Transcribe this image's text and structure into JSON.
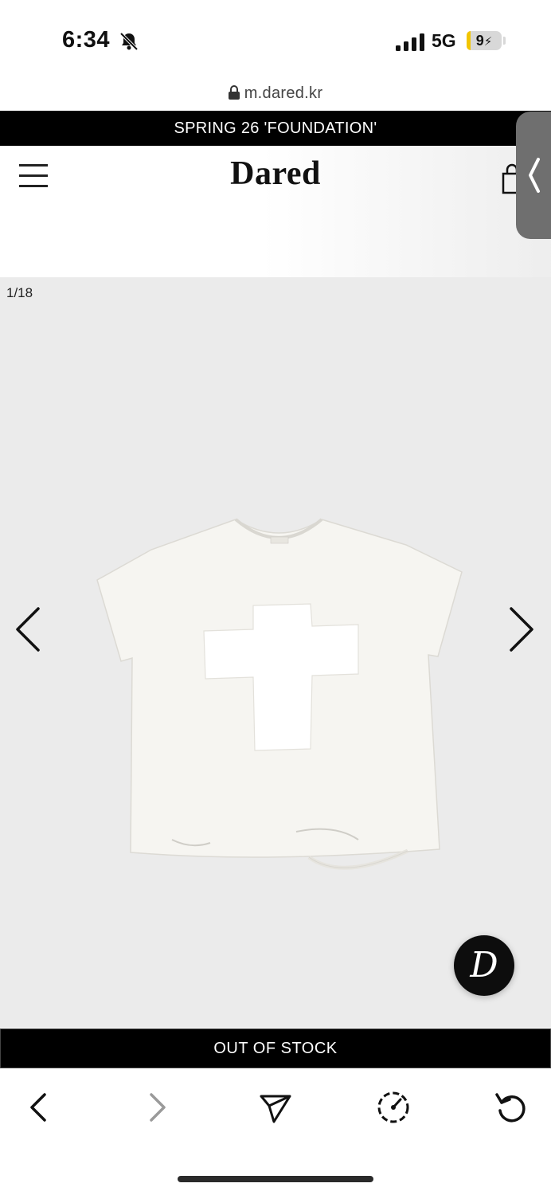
{
  "status_bar": {
    "time": "6:34",
    "network": "5G",
    "battery_level": "9",
    "battery_fraction": 0.09,
    "icons": [
      "bell-slash-icon",
      "signal-icon",
      "battery-charging-icon"
    ]
  },
  "browser": {
    "url": "m.dared.kr"
  },
  "announcement": {
    "text": "SPRING 26 'FOUNDATION'"
  },
  "header": {
    "logo": "Dared",
    "icons": [
      "menu-icon",
      "shopping-bag-icon",
      "side-panel-chevron-icon"
    ]
  },
  "gallery": {
    "counter": "1/18",
    "image_alt": "white t-shirt with cross patch",
    "badge_letter": "D"
  },
  "product": {
    "stock_label": "OUT OF STOCK"
  },
  "toolbar": {
    "buttons": [
      "back-icon",
      "forward-icon",
      "share-icon",
      "speed-icon",
      "reload-icon"
    ]
  },
  "colors": {
    "bar_black": "#000000",
    "gallery_bg": "#ebebeb",
    "battery_yellow": "#f2c500"
  }
}
